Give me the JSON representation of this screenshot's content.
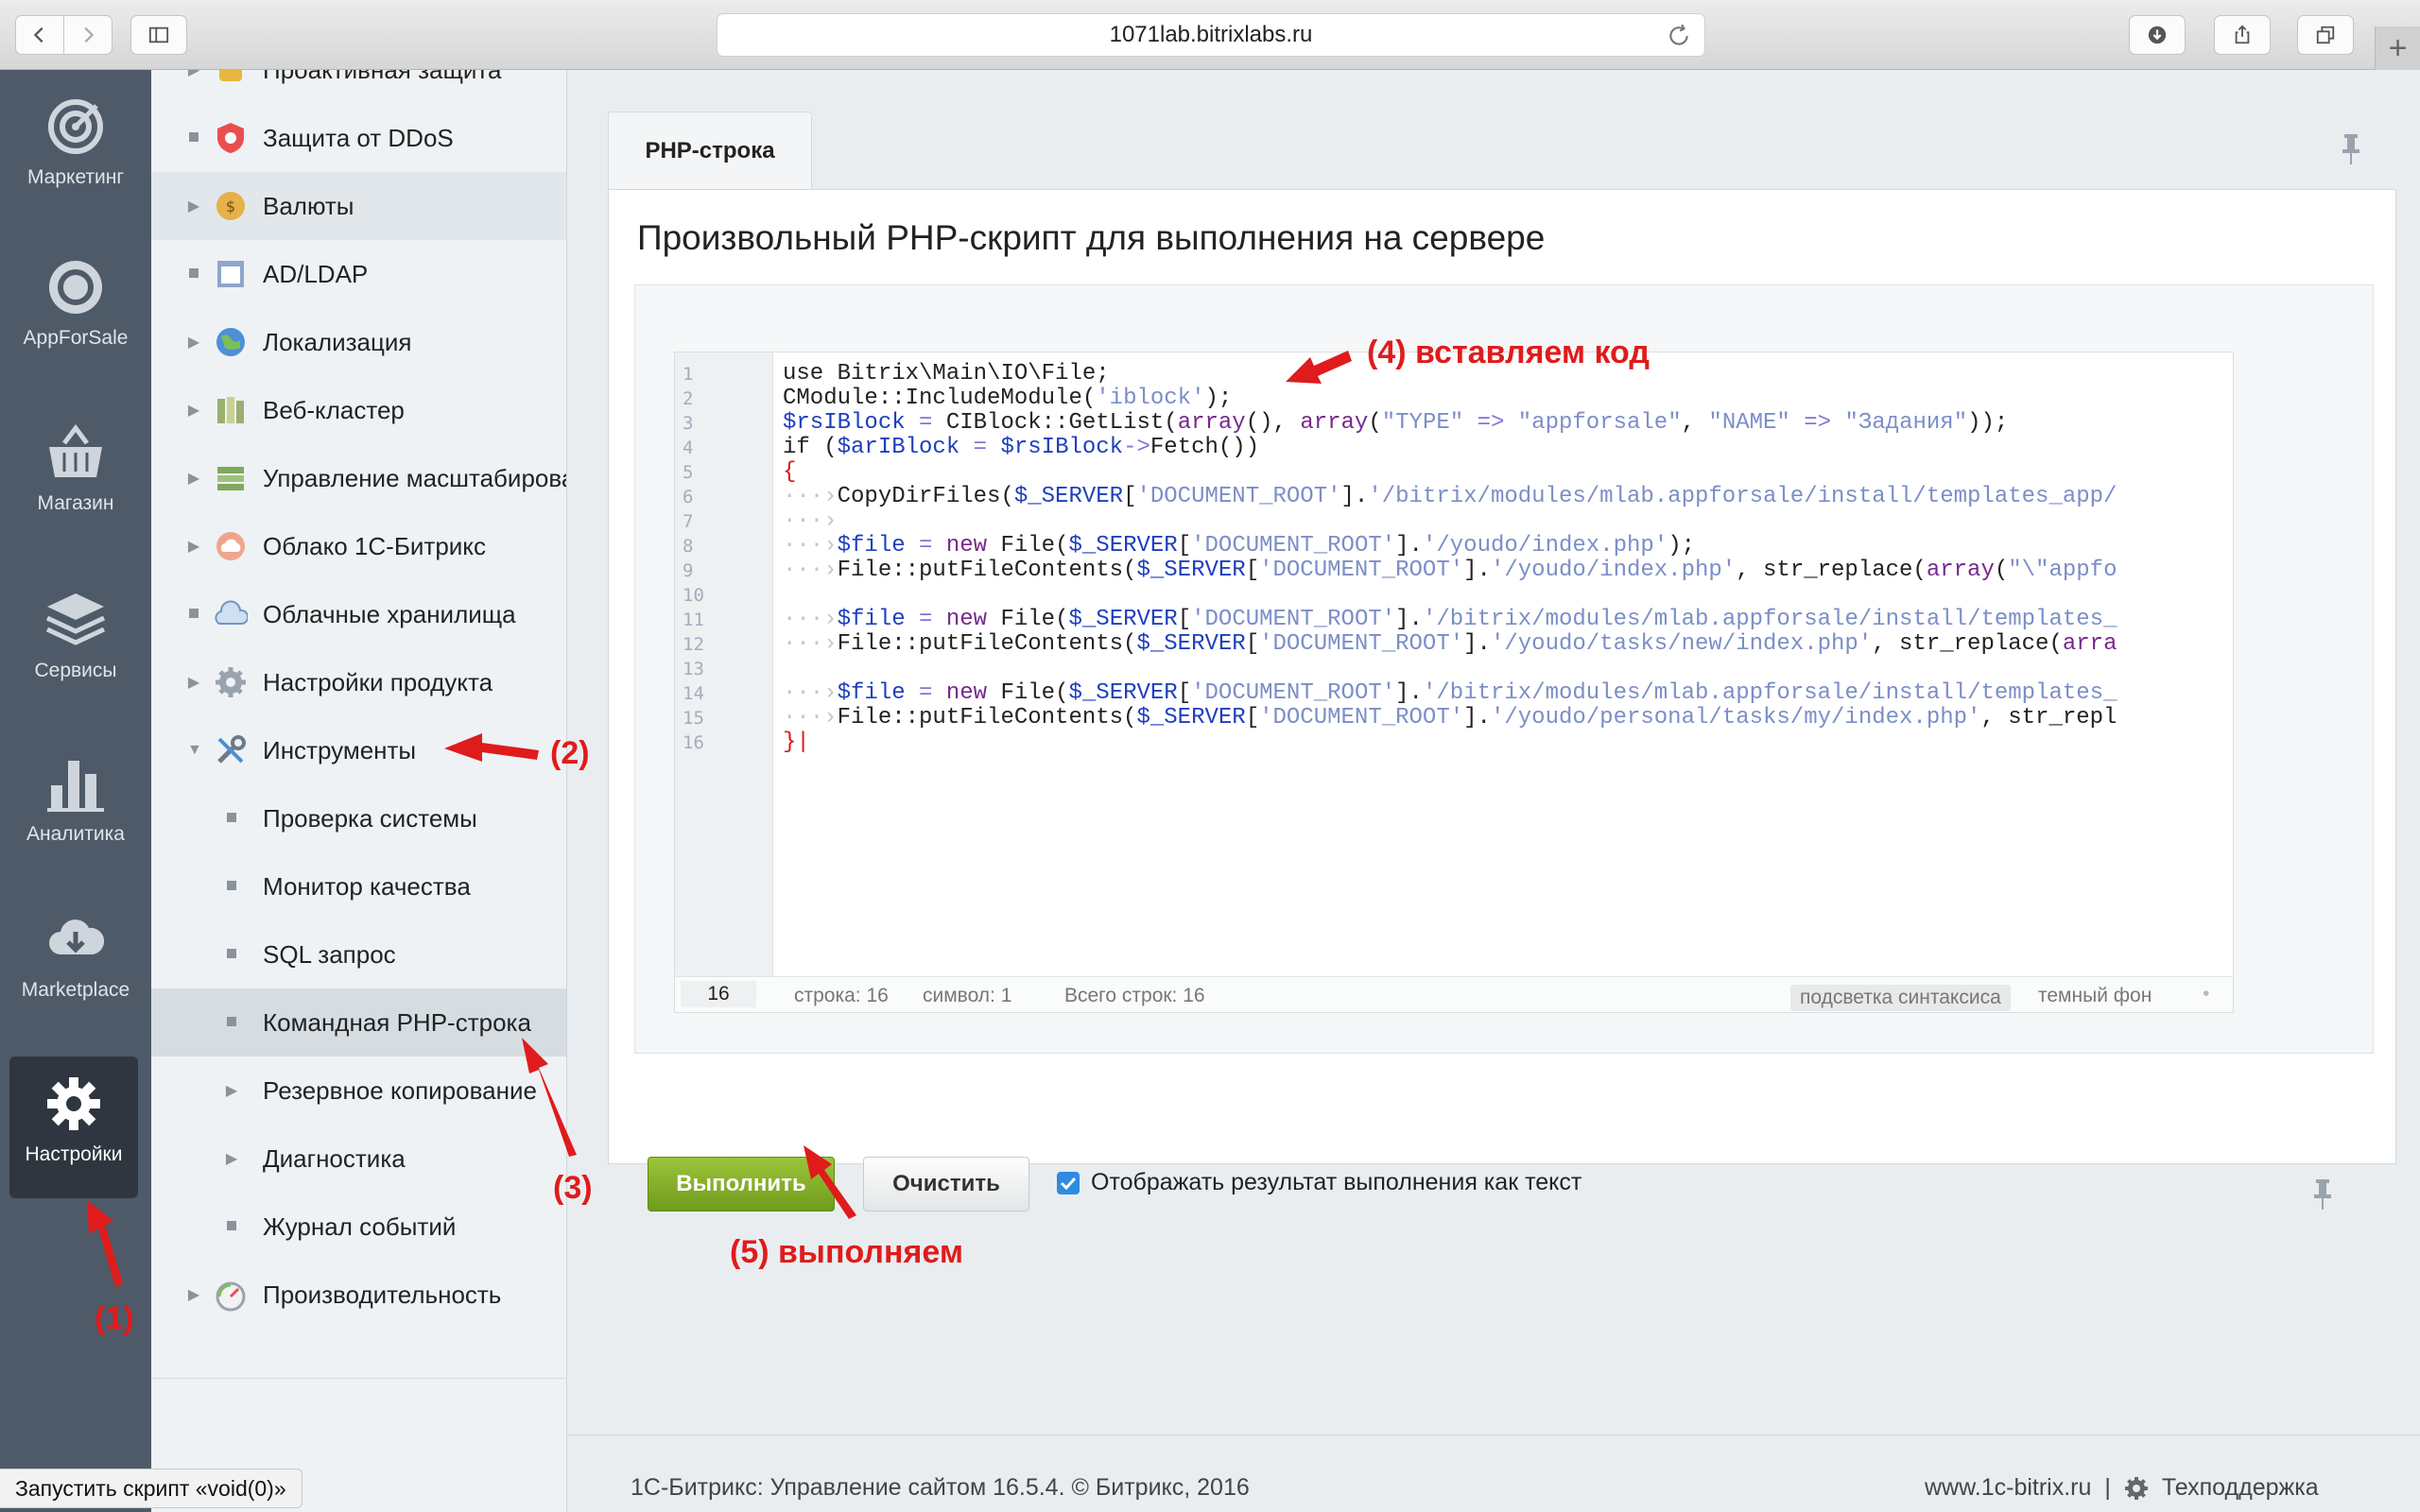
{
  "browser": {
    "url": "1071lab.bitrixlabs.ru"
  },
  "iconbar": {
    "items": [
      {
        "label": "Маркетинг",
        "icon": "target-icon"
      },
      {
        "label": "AppForSale",
        "icon": "at-icon"
      },
      {
        "label": "Магазин",
        "icon": "basket-icon"
      },
      {
        "label": "Сервисы",
        "icon": "layers-icon"
      },
      {
        "label": "Аналитика",
        "icon": "bar-chart-icon"
      },
      {
        "label": "Marketplace",
        "icon": "cloud-download-icon"
      },
      {
        "label": "Настройки",
        "icon": "gear-icon",
        "active": true
      }
    ]
  },
  "menu": {
    "items": [
      {
        "label": "Проактивная защита"
      },
      {
        "label": "Защита от DDoS"
      },
      {
        "label": "Валюты"
      },
      {
        "label": "AD/LDAP"
      },
      {
        "label": "Локализация"
      },
      {
        "label": "Веб-кластер"
      },
      {
        "label": "Управление масштабирования"
      },
      {
        "label": "Облако 1С-Битрикс"
      },
      {
        "label": "Облачные хранилища"
      },
      {
        "label": "Настройки продукта"
      },
      {
        "label": "Инструменты"
      },
      {
        "label": "Проверка системы"
      },
      {
        "label": "Монитор качества"
      },
      {
        "label": "SQL запрос"
      },
      {
        "label": "Командная PHP-строка"
      },
      {
        "label": "Резервное копирование"
      },
      {
        "label": "Диагностика"
      },
      {
        "label": "Журнал событий"
      },
      {
        "label": "Производительность"
      }
    ]
  },
  "main": {
    "tab_label": "PHP-строка",
    "title": "Произвольный PHP-скрипт для выполнения на сервере",
    "editor": {
      "line_numbers": [
        "1",
        "2",
        "3",
        "4",
        "5",
        "6",
        "7",
        "8",
        "9",
        "10",
        "11",
        "12",
        "13",
        "14",
        "15",
        "16"
      ],
      "status": {
        "current_line": "16",
        "row": "строка: 16",
        "col": "символ: 1",
        "total": "Всего строк: 16",
        "highlight": "подсветка синтаксиса",
        "dark": "темный фон"
      }
    },
    "run_button": "Выполнить",
    "clear_button": "Очистить",
    "checkbox_label": "Отображать результат выполнения как текст",
    "checkbox_checked": true
  },
  "footer": {
    "copyright": "1С-Битрикс: Управление сайтом 16.5.4. © Битрикс, 2016",
    "site_link": "www.1c-bitrix.ru",
    "separator": "|",
    "support": "Техподдержка"
  },
  "statusbar": "Запустить скрипт «void(0)»",
  "annotations": {
    "a1": "(1)",
    "a2": "(2)",
    "a3": "(3)",
    "a4": "(4) вставляем код",
    "a5": "(5) выполняем"
  },
  "colors": {
    "accent_annotation": "#e01b1b",
    "run_button": "#7fae25",
    "iconbar": "#4f5a68"
  }
}
